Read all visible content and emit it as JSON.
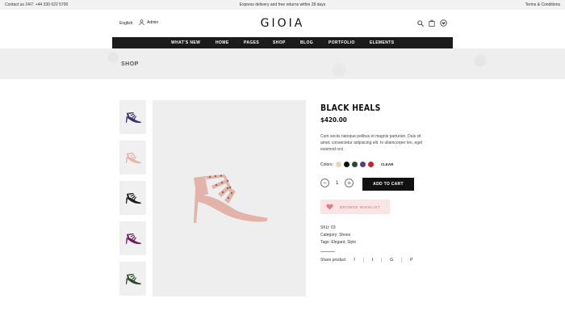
{
  "topbar": {
    "contact": "Contact us 24/7: +44 330 022 5700",
    "promo": "Express delivery and free returns within 28 days",
    "terms": "Terms & Conditions"
  },
  "header": {
    "language": "English",
    "account": "Admin",
    "logo": "GIOIA",
    "icons": [
      "search-icon",
      "cart-icon",
      "wishlist-icon"
    ]
  },
  "nav": {
    "items": [
      "WHAT'S NEW",
      "HOME",
      "PAGES",
      "SHOP",
      "BLOG",
      "PORTFOLIO",
      "ELEMENTS"
    ]
  },
  "banner": {
    "title": "SHOP"
  },
  "gallery": {
    "thumb_colors": [
      "#3a2f6a",
      "#e3b3aa",
      "#1c1c1c",
      "#6a1f5e",
      "#2f4a2a"
    ],
    "main_color": "#e3b3aa"
  },
  "product": {
    "name": "BLACK HEALS",
    "price": "$420.00",
    "description": "Cum sociis natoque pelibus et magnis parturien. Duis sit amet, consectetur adipiscing elit. In ullamcorper leo, eget euismod orci.",
    "colors_label": "Colors:",
    "colors": [
      "#e8d6b8",
      "#111111",
      "#2c4a2a",
      "#5b3a7a",
      "#c0262e"
    ],
    "clear_label": "CLEAR",
    "quantity": "1",
    "minus": "−",
    "plus": "+",
    "add_to_cart": "ADD TO CART",
    "wishlist": "BROWSE WISHLIST",
    "sku": "SKU: 03",
    "category": "Category: Shoes",
    "tags": "Tags: Elegant, Style",
    "share_label": "Share product",
    "share_icons": [
      "f",
      "t",
      "G",
      "P"
    ]
  }
}
